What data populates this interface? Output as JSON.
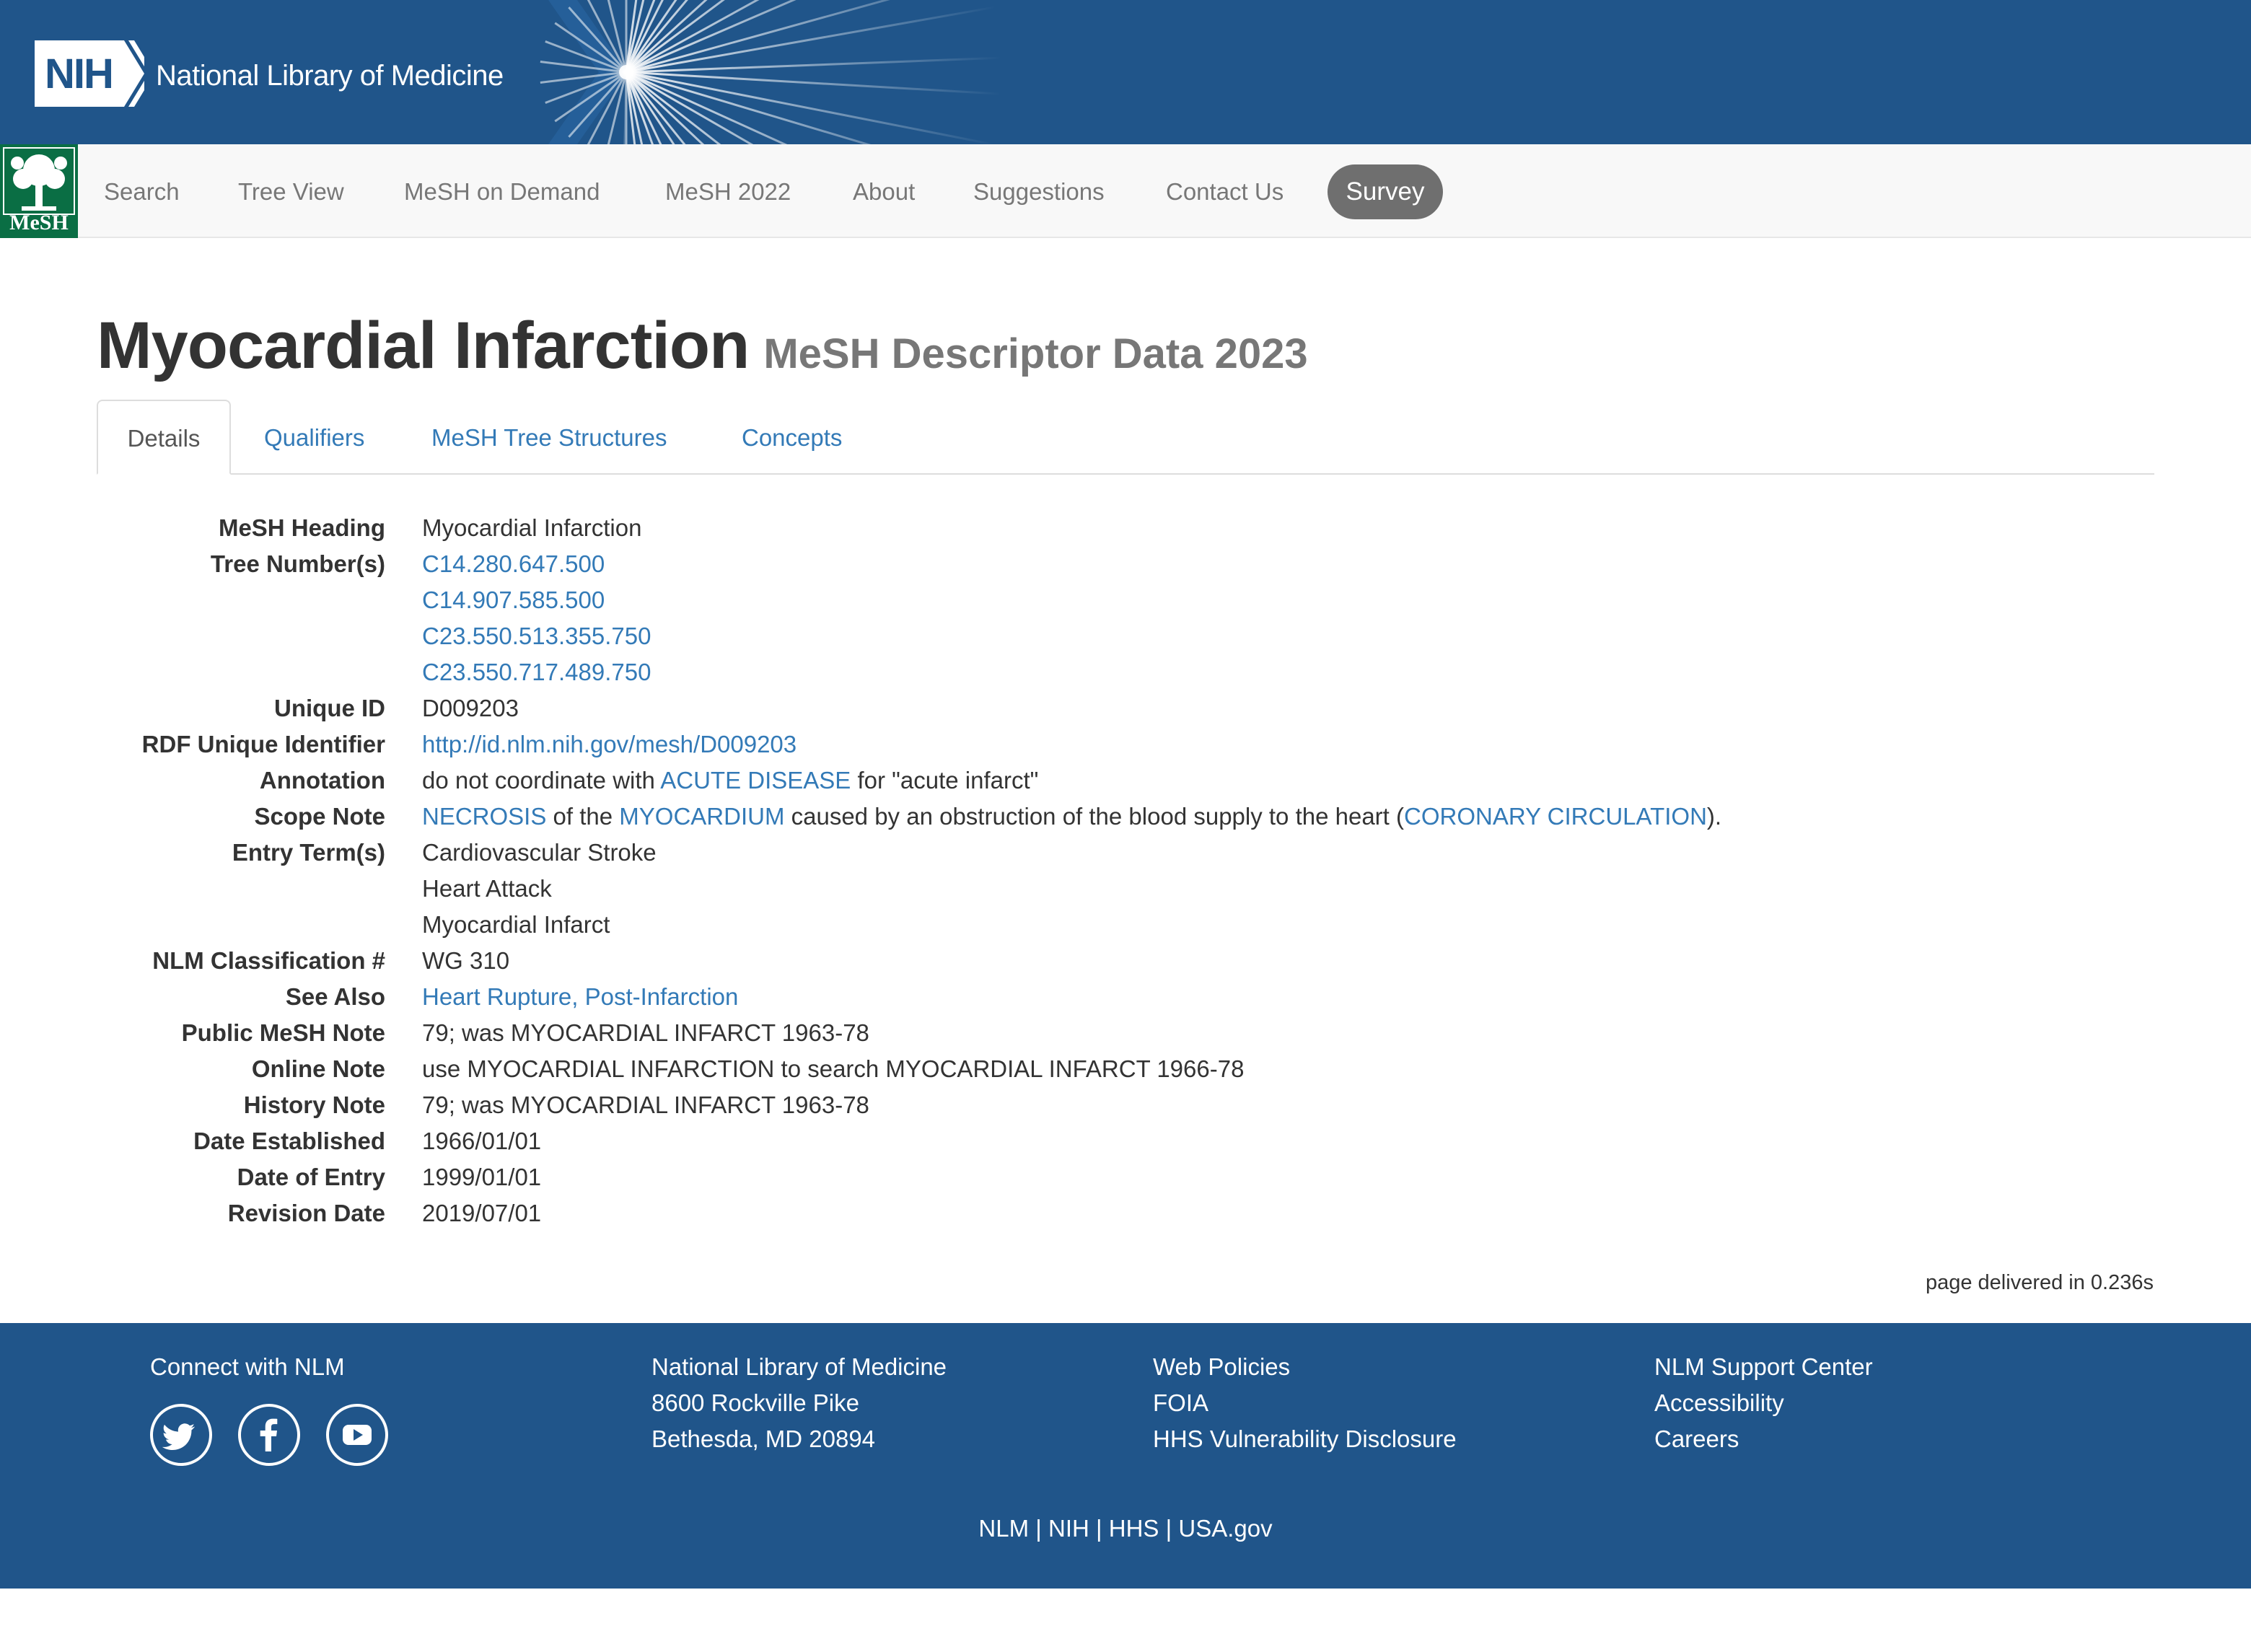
{
  "header": {
    "nih_label": "NIH",
    "org_title": "National Library of Medicine"
  },
  "nav": {
    "logo_label": "MeSH",
    "items": [
      "Search",
      "Tree View",
      "MeSH on Demand",
      "MeSH 2022",
      "About",
      "Suggestions",
      "Contact Us"
    ],
    "survey_label": "Survey"
  },
  "page": {
    "title": "Myocardial Infarction",
    "subtitle": "MeSH Descriptor Data 2023"
  },
  "tabs": [
    "Details",
    "Qualifiers",
    "MeSH Tree Structures",
    "Concepts"
  ],
  "details": {
    "mesh_heading": {
      "label": "MeSH Heading",
      "value": "Myocardial Infarction"
    },
    "tree_numbers": {
      "label": "Tree Number(s)",
      "values": [
        "C14.280.647.500",
        "C14.907.585.500",
        "C23.550.513.355.750",
        "C23.550.717.489.750"
      ]
    },
    "unique_id": {
      "label": "Unique ID",
      "value": "D009203"
    },
    "rdf_id": {
      "label": "RDF Unique Identifier",
      "value": "http://id.nlm.nih.gov/mesh/D009203"
    },
    "annotation": {
      "label": "Annotation",
      "prefix": "do not coordinate with ",
      "link": "ACUTE DISEASE",
      "suffix": " for \"acute infarct\""
    },
    "scope_note": {
      "label": "Scope Note",
      "link1": "NECROSIS",
      "text1": " of the ",
      "link2": "MYOCARDIUM",
      "text2": " caused by an obstruction of the blood supply to the heart (",
      "link3": "CORONARY CIRCULATION",
      "text3": ")."
    },
    "entry_terms": {
      "label": "Entry Term(s)",
      "values": [
        "Cardiovascular Stroke",
        "Heart Attack",
        "Myocardial Infarct"
      ]
    },
    "nlm_class": {
      "label": "NLM Classification #",
      "value": "WG 310"
    },
    "see_also": {
      "label": "See Also",
      "value": "Heart Rupture, Post-Infarction"
    },
    "public_note": {
      "label": "Public MeSH Note",
      "value": "79; was MYOCARDIAL INFARCT 1963-78"
    },
    "online_note": {
      "label": "Online Note",
      "value": "use MYOCARDIAL INFARCTION to search MYOCARDIAL INFARCT 1966-78"
    },
    "history_note": {
      "label": "History Note",
      "value": "79; was MYOCARDIAL INFARCT 1963-78"
    },
    "date_established": {
      "label": "Date Established",
      "value": "1966/01/01"
    },
    "date_entry": {
      "label": "Date of Entry",
      "value": "1999/01/01"
    },
    "revision_date": {
      "label": "Revision Date",
      "value": "2019/07/01"
    }
  },
  "delivered": "page delivered in 0.236s",
  "footer": {
    "connect": "Connect with NLM",
    "address": [
      "National Library of Medicine",
      "8600 Rockville Pike",
      "Bethesda, MD 20894"
    ],
    "policies": [
      "Web Policies",
      "FOIA",
      "HHS Vulnerability Disclosure"
    ],
    "support": [
      "NLM Support Center",
      "Accessibility",
      "Careers"
    ],
    "bottom_links": [
      "NLM",
      "NIH",
      "HHS",
      "USA.gov"
    ],
    "separator": "|",
    "social_icons": [
      "twitter-icon",
      "facebook-icon",
      "youtube-icon"
    ]
  },
  "colors": {
    "brand_blue": "#20558a",
    "link": "#337ab7",
    "mesh_green": "#0a6e44",
    "survey_pill": "#6f6f6f"
  }
}
